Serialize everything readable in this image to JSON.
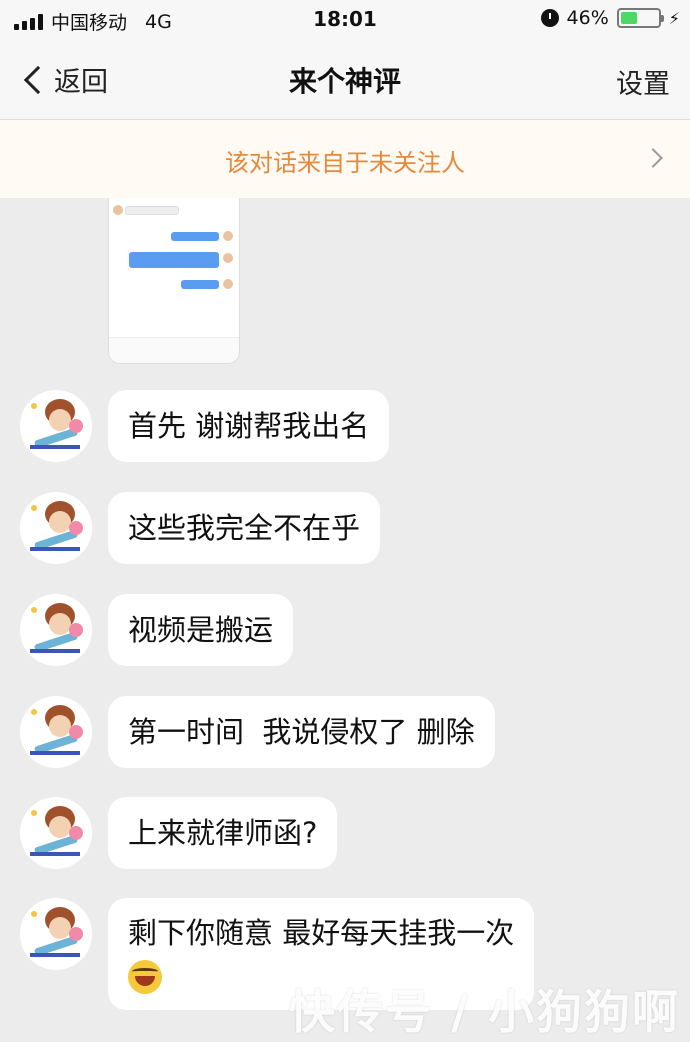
{
  "status_bar": {
    "carrier": "中国移动",
    "network": "4G",
    "time": "18:01",
    "battery_percent": "46%",
    "battery_level": 0.46,
    "icons": [
      "signal-icon",
      "alarm-icon",
      "battery-icon",
      "charging-bolt-icon"
    ]
  },
  "nav": {
    "back_label": "返回",
    "title": "来个神评",
    "settings_label": "设置"
  },
  "banner": {
    "text": "该对话来自于未关注人"
  },
  "messages": [
    {
      "text": "首先 谢谢帮我出名",
      "emoji": ""
    },
    {
      "text": "这些我完全不在乎",
      "emoji": ""
    },
    {
      "text": "视频是搬运",
      "emoji": ""
    },
    {
      "text": "第一时间  我说侵权了 删除",
      "emoji": ""
    },
    {
      "text": "上来就律师函?",
      "emoji": ""
    },
    {
      "text": "剩下你随意 最好每天挂我一次",
      "emoji": "laugh-icon"
    }
  ],
  "watermark": "快传号 / 小狗狗啊",
  "colors": {
    "background": "#ececec",
    "banner_text": "#e58a3a",
    "battery": "#4cd964"
  }
}
